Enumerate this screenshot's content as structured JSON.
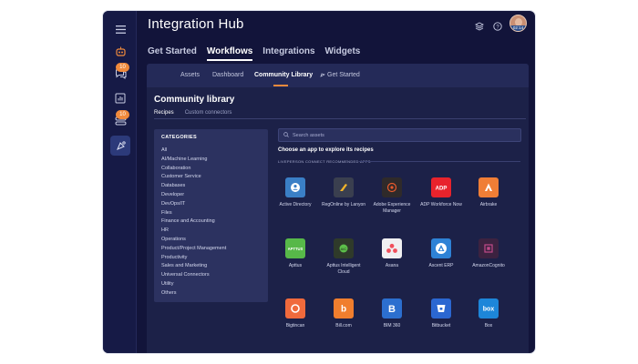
{
  "header": {
    "title": "Integration Hub",
    "avatar_time": "02:14"
  },
  "rail": {
    "badge_1": "10",
    "badge_2": "10"
  },
  "main_nav": [
    "Get Started",
    "Workflows",
    "Integrations",
    "Widgets"
  ],
  "sub_nav": [
    "Assets",
    "Dashboard",
    "Community Library",
    "Get Started"
  ],
  "page": {
    "title": "Community library",
    "tabs": [
      "Recipes",
      "Custom connectors"
    ]
  },
  "categories": {
    "header": "CATEGORIES",
    "items": [
      "All",
      "AI/Machine Learning",
      "Collaboration",
      "Customer Service",
      "Databases",
      "Developer",
      "DevOps/IT",
      "Files",
      "Finance and Accounting",
      "HR",
      "Operations",
      "Product/Project Management",
      "Productivity",
      "Sales and Marketing",
      "Universal Connectors",
      "Utility",
      "Others"
    ]
  },
  "search": {
    "placeholder": "Search assets"
  },
  "apps_section": {
    "prompt": "Choose an app to explore its recipes",
    "recommended_label": "LIVEPERSON CONNECT RECOMMENDED APPS"
  },
  "apps": [
    {
      "name": "Active Directory",
      "color": "#3a7fc6",
      "icon": "user-icon"
    },
    {
      "name": "RegOnline by Lanyon",
      "color": "#3a3f4f",
      "icon": "lanyon-icon"
    },
    {
      "name": "Adobe Experience Manager",
      "color": "#2f2a2a",
      "icon": "adobe-icon"
    },
    {
      "name": "ADP Workforce Now",
      "color": "#e8232c",
      "icon": "adp-icon"
    },
    {
      "name": "Airbrake",
      "color": "#f07e36",
      "icon": "airbrake-icon"
    },
    {
      "name": "Apttus",
      "color": "#57b849",
      "icon": "apttus-icon"
    },
    {
      "name": "Apttus Intelligent Cloud",
      "color": "#2f3a2a",
      "icon": "apttus-cloud-icon"
    },
    {
      "name": "Asana",
      "color": "#f0f0f2",
      "icon": "asana-icon"
    },
    {
      "name": "Ascent ERP",
      "color": "#2e82d6",
      "icon": "ascent-icon"
    },
    {
      "name": "AmazonCognito",
      "color": "#3c2240",
      "icon": "cognito-icon"
    },
    {
      "name": "Bigtincan",
      "color": "#f06a3c",
      "icon": "bigtincan-icon"
    },
    {
      "name": "Bill.com",
      "color": "#f07e2e",
      "icon": "bill-icon"
    },
    {
      "name": "BIM 360",
      "color": "#2c6fcf",
      "icon": "bim-icon"
    },
    {
      "name": "Bitbucket",
      "color": "#2b67d1",
      "icon": "bitbucket-icon"
    },
    {
      "name": "Box",
      "color": "#1d86d9",
      "icon": "box-icon"
    }
  ]
}
